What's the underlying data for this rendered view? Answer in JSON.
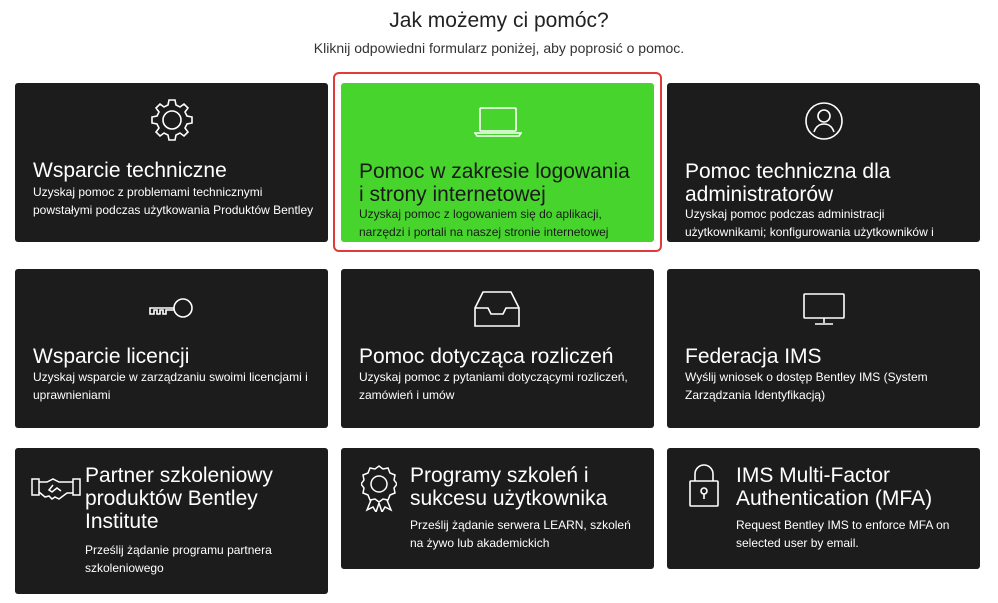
{
  "page": {
    "heading": "Jak możemy ci pomóc?",
    "subheading": "Kliknij odpowiedni formularz poniżej, aby poprosić o pomoc."
  },
  "cards": [
    {
      "title": "Wsparcie techniczne",
      "desc": "Uzyskaj pomoc z problemami technicznymi powstałymi podczas użytkowania Produktów Bentley",
      "icon": "gear-icon"
    },
    {
      "title": "Pomoc w zakresie logowania i strony internetowej",
      "desc": "Uzyskaj pomoc z logowaniem się do aplikacji, narzędzi i portali na naszej stronie internetowej",
      "icon": "laptop-icon",
      "bg": "#47d52d"
    },
    {
      "title": "Pomoc techniczna dla administratorów",
      "desc": "Uzyskaj pomoc podczas administracji użytkownikami; konfigurowania użytkowników i uprawnień",
      "icon": "user-circle-icon"
    },
    {
      "title": "Wsparcie licencji",
      "desc": "Uzyskaj wsparcie w zarządzaniu swoimi licencjami i uprawnieniami",
      "icon": "key-icon"
    },
    {
      "title": "Pomoc dotycząca rozliczeń",
      "desc": "Uzyskaj pomoc z pytaniami dotyczącymi rozliczeń, zamówień i umów",
      "icon": "inbox-tray-icon"
    },
    {
      "title": "Federacja IMS",
      "desc": "Wyślij wniosek o dostęp Bentley IMS (System Zarządzania Identyfikacją)",
      "icon": "monitor-icon"
    },
    {
      "title": "Partner szkoleniowy produktów Bentley Institute",
      "desc": "Prześlij żądanie programu partnera szkoleniowego",
      "icon": "handshake-icon"
    },
    {
      "title": "Programy szkoleń i sukcesu użytkownika",
      "desc": "Prześlij żądanie serwera LEARN, szkoleń na żywo lub akademickich",
      "icon": "award-icon"
    },
    {
      "title": "IMS Multi-Factor Authentication (MFA)",
      "desc": "Request Bentley IMS to enforce MFA on selected user by email.",
      "icon": "lock-icon"
    }
  ],
  "colors": {
    "card_bg": "#1c1c1c",
    "highlight_card_bg": "#47d52d",
    "highlight_border": "#e03a3a"
  }
}
